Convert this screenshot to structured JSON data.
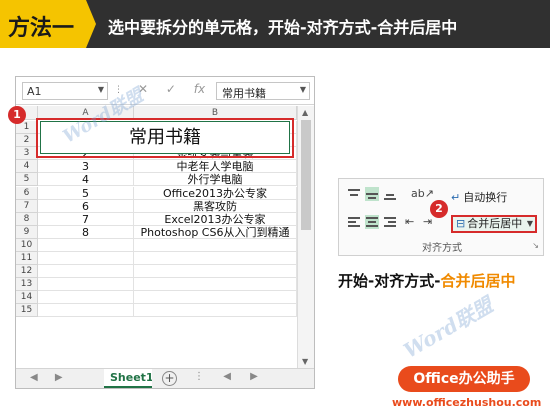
{
  "banner": {
    "method_label": "方法一",
    "instruction": "选中要拆分的单元格，开始-对齐方式-合并后居中"
  },
  "excel": {
    "name_box": "A1",
    "formula_icons": [
      "cancel-icon",
      "enter-icon",
      "fx-icon"
    ],
    "formula_icon_glyphs": [
      "✕",
      "✓",
      "fx"
    ],
    "formula_content": "常用书籍",
    "columns": [
      "A",
      "B"
    ],
    "merged_title": "常用书籍",
    "rows": [
      {
        "row": "1",
        "a": "",
        "b": ""
      },
      {
        "row": "2",
        "a": "",
        "b": ""
      },
      {
        "row": "3",
        "a": "2",
        "b": "系统安装与重装"
      },
      {
        "row": "4",
        "a": "3",
        "b": "中老年人学电脑"
      },
      {
        "row": "5",
        "a": "4",
        "b": "外行学电脑"
      },
      {
        "row": "6",
        "a": "5",
        "b": "Office2013办公专家"
      },
      {
        "row": "7",
        "a": "6",
        "b": "黑客攻防"
      },
      {
        "row": "8",
        "a": "7",
        "b": "Excel2013办公专家"
      },
      {
        "row": "9",
        "a": "8",
        "b": "Photoshop CS6从入门到精通"
      },
      {
        "row": "10",
        "a": "",
        "b": ""
      },
      {
        "row": "11",
        "a": "",
        "b": ""
      },
      {
        "row": "12",
        "a": "",
        "b": ""
      },
      {
        "row": "13",
        "a": "",
        "b": ""
      },
      {
        "row": "14",
        "a": "",
        "b": ""
      },
      {
        "row": "15",
        "a": "",
        "b": ""
      }
    ],
    "sheet_tab": "Sheet1",
    "step_badge": "1"
  },
  "ribbon": {
    "wrap_text_label": "自动换行",
    "merge_center_label": "合并后居中",
    "group_label": "对齐方式",
    "step_badge": "2"
  },
  "caption": {
    "part1": "开始-对齐方式-",
    "part2": "合并后居中"
  },
  "watermark_text": "Word联盟",
  "brand": {
    "name": "Office办公助手",
    "url": "www.officezhushou.com"
  },
  "colors": {
    "banner_bg": "#303030",
    "method_tag": "#f5c400",
    "highlight_red": "#d62b2b",
    "excel_green": "#217346",
    "caption_orange": "#f08a00",
    "brand_orange": "#e94b1c"
  }
}
